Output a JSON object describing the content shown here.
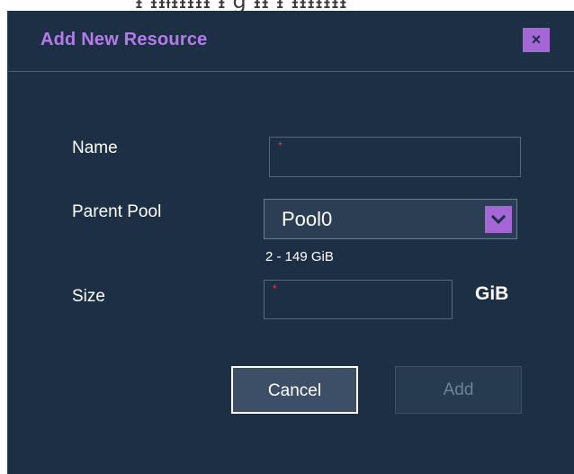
{
  "background": {
    "partial_text": "ᵻ ᵻᵻᵼᵻᵻᵻᵻᵻ   ᵻ   g    ᵻᵻ  ᵻ ᵻᵻᵻᵻᵻᵻᵻ"
  },
  "dialog": {
    "title": "Add New Resource",
    "close_label": "×",
    "fields": {
      "name": {
        "label": "Name",
        "value": "",
        "required_mark": "*"
      },
      "parent_pool": {
        "label": "Parent Pool",
        "selected": "Pool0",
        "hint": "2 - 149 GiB"
      },
      "size": {
        "label": "Size",
        "value": "",
        "required_mark": "*",
        "unit": "GiB"
      }
    },
    "buttons": {
      "cancel": "Cancel",
      "add": "Add"
    }
  },
  "colors": {
    "panel": "#1c2f45",
    "accent": "#a667d6",
    "title": "#b57bea",
    "required": "#e43c3c",
    "disabled_text": "#6f8296"
  },
  "icons": {
    "close": "close-icon",
    "dropdown": "chevron-down-icon"
  }
}
